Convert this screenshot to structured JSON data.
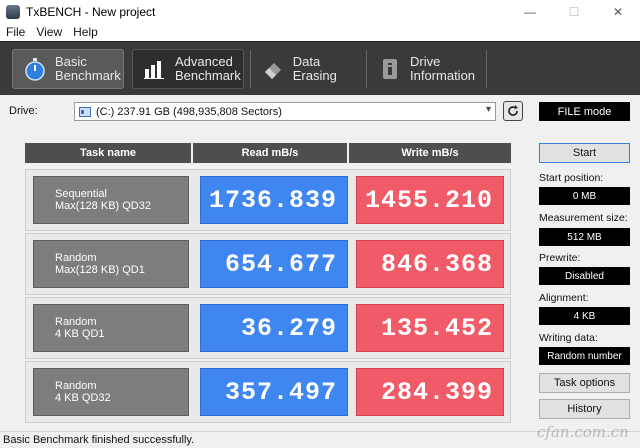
{
  "window": {
    "title": "TxBENCH - New project",
    "minimize_glyph": "—",
    "maximize_glyph": "☐",
    "close_glyph": "✕"
  },
  "menu": [
    "File",
    "View",
    "Help"
  ],
  "tabs": [
    {
      "line1": "Basic",
      "line2": "Benchmark",
      "icon": "stopwatch-icon"
    },
    {
      "line1": "Advanced",
      "line2": "Benchmark",
      "icon": "bar-chart-icon"
    },
    {
      "line1": "Data Erasing",
      "line2": "",
      "icon": "eraser-icon"
    },
    {
      "line1": "Drive",
      "line2": "Information",
      "icon": "drive-info-icon"
    }
  ],
  "drive": {
    "label": "Drive:",
    "value": "(C:)  237.91 GB (498,935,808 Sectors)",
    "mode": "FILE mode"
  },
  "table": {
    "headers": [
      "Task name",
      "Read mB/s",
      "Write mB/s"
    ],
    "rows": [
      {
        "line1": "Sequential",
        "line2": "Max(128 KB) QD32",
        "read": "1736.839",
        "write": "1455.210"
      },
      {
        "line1": "Random",
        "line2": "Max(128 KB) QD1",
        "read": "654.677",
        "write": "846.368"
      },
      {
        "line1": "Random",
        "line2": "4 KB QD1",
        "read": "36.279",
        "write": "135.452"
      },
      {
        "line1": "Random",
        "line2": "4 KB QD32",
        "read": "357.497",
        "write": "284.399"
      }
    ]
  },
  "panel": {
    "start": "Start",
    "start_position_label": "Start position:",
    "start_position": "0 MB",
    "measurement_size_label": "Measurement size:",
    "measurement_size": "512 MB",
    "prewrite_label": "Prewrite:",
    "prewrite": "Disabled",
    "alignment_label": "Alignment:",
    "alignment": "4 KB",
    "writing_data_label": "Writing data:",
    "writing_data": "Random number",
    "task_options": "Task options",
    "history": "History"
  },
  "status": "Basic Benchmark finished successfully.",
  "watermark": "cfan.com.cn",
  "colors": {
    "read": "#3f86f0",
    "write": "#f05b67",
    "toolbar": "#3a3a3a"
  }
}
